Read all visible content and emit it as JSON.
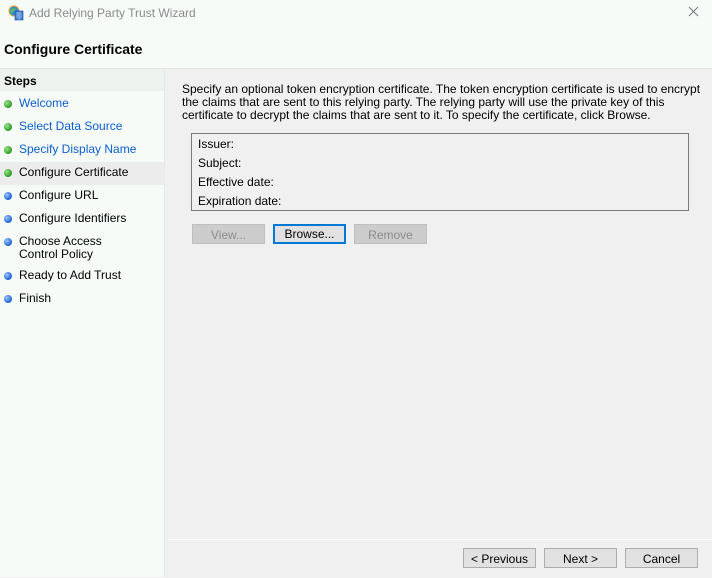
{
  "window": {
    "title": "Add Relying Party Trust Wizard",
    "app_icon": "wizard-globe-icon",
    "close_icon": "close-icon"
  },
  "header": {
    "page_title": "Configure Certificate"
  },
  "sidebar": {
    "heading": "Steps",
    "items": [
      {
        "label": "Welcome",
        "status": "completed"
      },
      {
        "label": "Select Data Source",
        "status": "completed"
      },
      {
        "label": "Specify Display Name",
        "status": "completed"
      },
      {
        "label": "Configure Certificate",
        "status": "current"
      },
      {
        "label": "Configure URL",
        "status": "pending"
      },
      {
        "label": "Configure Identifiers",
        "status": "pending"
      },
      {
        "label": "Choose Access Control Policy",
        "status": "pending"
      },
      {
        "label": "Ready to Add Trust",
        "status": "pending"
      },
      {
        "label": "Finish",
        "status": "pending"
      }
    ]
  },
  "main": {
    "description": "Specify an optional token encryption certificate.  The token encryption certificate is used to encrypt the claims that are sent to this relying party.  The relying party will use the private key of this certificate to decrypt the claims that are sent to it.  To specify the certificate, click Browse.",
    "certificate": {
      "issuer_label": "Issuer:",
      "subject_label": "Subject:",
      "effective_date_label": "Effective date:",
      "expiration_date_label": "Expiration date:"
    },
    "buttons": {
      "view": "View...",
      "browse": "Browse...",
      "remove": "Remove"
    }
  },
  "footer": {
    "previous": "< Previous",
    "next": "Next >",
    "cancel": "Cancel"
  },
  "colors": {
    "link": "#0b5fd0",
    "focus": "#0078d7",
    "completed_dot": "#2a9d1f",
    "pending_dot": "#1c5fd6"
  }
}
